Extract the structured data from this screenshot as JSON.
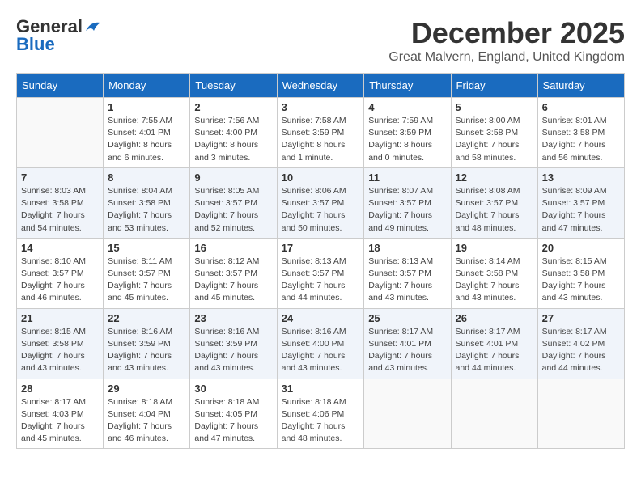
{
  "header": {
    "logo_line1": "General",
    "logo_line2": "Blue",
    "month": "December 2025",
    "location": "Great Malvern, England, United Kingdom"
  },
  "days_of_week": [
    "Sunday",
    "Monday",
    "Tuesday",
    "Wednesday",
    "Thursday",
    "Friday",
    "Saturday"
  ],
  "weeks": [
    [
      {
        "day": "",
        "info": ""
      },
      {
        "day": "1",
        "info": "Sunrise: 7:55 AM\nSunset: 4:01 PM\nDaylight: 8 hours\nand 6 minutes."
      },
      {
        "day": "2",
        "info": "Sunrise: 7:56 AM\nSunset: 4:00 PM\nDaylight: 8 hours\nand 3 minutes."
      },
      {
        "day": "3",
        "info": "Sunrise: 7:58 AM\nSunset: 3:59 PM\nDaylight: 8 hours\nand 1 minute."
      },
      {
        "day": "4",
        "info": "Sunrise: 7:59 AM\nSunset: 3:59 PM\nDaylight: 8 hours\nand 0 minutes."
      },
      {
        "day": "5",
        "info": "Sunrise: 8:00 AM\nSunset: 3:58 PM\nDaylight: 7 hours\nand 58 minutes."
      },
      {
        "day": "6",
        "info": "Sunrise: 8:01 AM\nSunset: 3:58 PM\nDaylight: 7 hours\nand 56 minutes."
      }
    ],
    [
      {
        "day": "7",
        "info": "Sunrise: 8:03 AM\nSunset: 3:58 PM\nDaylight: 7 hours\nand 54 minutes."
      },
      {
        "day": "8",
        "info": "Sunrise: 8:04 AM\nSunset: 3:58 PM\nDaylight: 7 hours\nand 53 minutes."
      },
      {
        "day": "9",
        "info": "Sunrise: 8:05 AM\nSunset: 3:57 PM\nDaylight: 7 hours\nand 52 minutes."
      },
      {
        "day": "10",
        "info": "Sunrise: 8:06 AM\nSunset: 3:57 PM\nDaylight: 7 hours\nand 50 minutes."
      },
      {
        "day": "11",
        "info": "Sunrise: 8:07 AM\nSunset: 3:57 PM\nDaylight: 7 hours\nand 49 minutes."
      },
      {
        "day": "12",
        "info": "Sunrise: 8:08 AM\nSunset: 3:57 PM\nDaylight: 7 hours\nand 48 minutes."
      },
      {
        "day": "13",
        "info": "Sunrise: 8:09 AM\nSunset: 3:57 PM\nDaylight: 7 hours\nand 47 minutes."
      }
    ],
    [
      {
        "day": "14",
        "info": "Sunrise: 8:10 AM\nSunset: 3:57 PM\nDaylight: 7 hours\nand 46 minutes."
      },
      {
        "day": "15",
        "info": "Sunrise: 8:11 AM\nSunset: 3:57 PM\nDaylight: 7 hours\nand 45 minutes."
      },
      {
        "day": "16",
        "info": "Sunrise: 8:12 AM\nSunset: 3:57 PM\nDaylight: 7 hours\nand 45 minutes."
      },
      {
        "day": "17",
        "info": "Sunrise: 8:13 AM\nSunset: 3:57 PM\nDaylight: 7 hours\nand 44 minutes."
      },
      {
        "day": "18",
        "info": "Sunrise: 8:13 AM\nSunset: 3:57 PM\nDaylight: 7 hours\nand 43 minutes."
      },
      {
        "day": "19",
        "info": "Sunrise: 8:14 AM\nSunset: 3:58 PM\nDaylight: 7 hours\nand 43 minutes."
      },
      {
        "day": "20",
        "info": "Sunrise: 8:15 AM\nSunset: 3:58 PM\nDaylight: 7 hours\nand 43 minutes."
      }
    ],
    [
      {
        "day": "21",
        "info": "Sunrise: 8:15 AM\nSunset: 3:58 PM\nDaylight: 7 hours\nand 43 minutes."
      },
      {
        "day": "22",
        "info": "Sunrise: 8:16 AM\nSunset: 3:59 PM\nDaylight: 7 hours\nand 43 minutes."
      },
      {
        "day": "23",
        "info": "Sunrise: 8:16 AM\nSunset: 3:59 PM\nDaylight: 7 hours\nand 43 minutes."
      },
      {
        "day": "24",
        "info": "Sunrise: 8:16 AM\nSunset: 4:00 PM\nDaylight: 7 hours\nand 43 minutes."
      },
      {
        "day": "25",
        "info": "Sunrise: 8:17 AM\nSunset: 4:01 PM\nDaylight: 7 hours\nand 43 minutes."
      },
      {
        "day": "26",
        "info": "Sunrise: 8:17 AM\nSunset: 4:01 PM\nDaylight: 7 hours\nand 44 minutes."
      },
      {
        "day": "27",
        "info": "Sunrise: 8:17 AM\nSunset: 4:02 PM\nDaylight: 7 hours\nand 44 minutes."
      }
    ],
    [
      {
        "day": "28",
        "info": "Sunrise: 8:17 AM\nSunset: 4:03 PM\nDaylight: 7 hours\nand 45 minutes."
      },
      {
        "day": "29",
        "info": "Sunrise: 8:18 AM\nSunset: 4:04 PM\nDaylight: 7 hours\nand 46 minutes."
      },
      {
        "day": "30",
        "info": "Sunrise: 8:18 AM\nSunset: 4:05 PM\nDaylight: 7 hours\nand 47 minutes."
      },
      {
        "day": "31",
        "info": "Sunrise: 8:18 AM\nSunset: 4:06 PM\nDaylight: 7 hours\nand 48 minutes."
      },
      {
        "day": "",
        "info": ""
      },
      {
        "day": "",
        "info": ""
      },
      {
        "day": "",
        "info": ""
      }
    ]
  ]
}
